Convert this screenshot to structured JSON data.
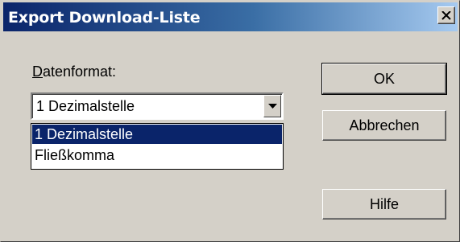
{
  "dialog": {
    "title": "Export Download-Liste",
    "close_label": "Close"
  },
  "format": {
    "label_accel": "D",
    "label_rest": "atenformat:",
    "selected_value": "1 Dezimalstelle",
    "options": [
      "1 Dezimalstelle",
      "Fließkomma"
    ]
  },
  "buttons": {
    "ok": "OK",
    "cancel": "Abbrechen",
    "help": "Hilfe"
  },
  "colors": {
    "titlebar_start": "#0a246a",
    "titlebar_end": "#a6caf0",
    "selection": "#0a246a",
    "face": "#d4d0c8"
  },
  "icons": {
    "close": "close-icon",
    "dropdown": "chevron-down-icon"
  }
}
